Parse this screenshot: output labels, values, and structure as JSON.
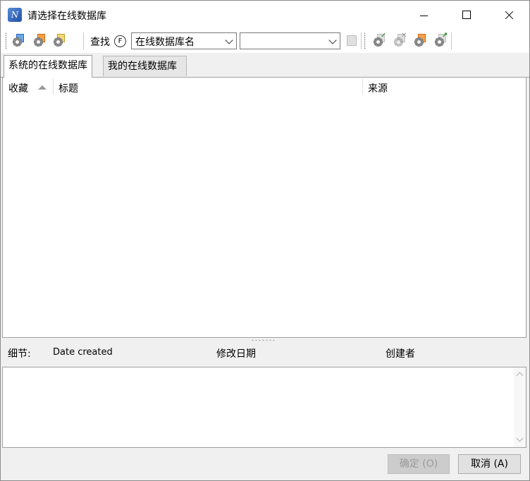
{
  "window": {
    "title": "请选择在线数据库",
    "app_icon_letter": "N"
  },
  "toolbar": {
    "find_label": "查找",
    "find_accel": "F",
    "search_field_combo": "在线数据库名",
    "search_text_combo": ""
  },
  "tabs": [
    {
      "label": "系统的在线数据库",
      "active": true
    },
    {
      "label": "我的在线数据库",
      "active": false
    }
  ],
  "list": {
    "columns": [
      "收藏",
      "标题",
      "来源"
    ],
    "sort_column": "收藏",
    "rows": []
  },
  "details": {
    "label": "细节:",
    "date_created": "Date created",
    "modified": "修改日期",
    "creator": "创建者"
  },
  "buttons": {
    "ok": "确定 (O)",
    "cancel": "取消 (A)"
  },
  "colors": {
    "dialog_bg": "#f0f0f0",
    "disabled_button": "#cccccc",
    "app_icon": "#1d4fa6"
  }
}
